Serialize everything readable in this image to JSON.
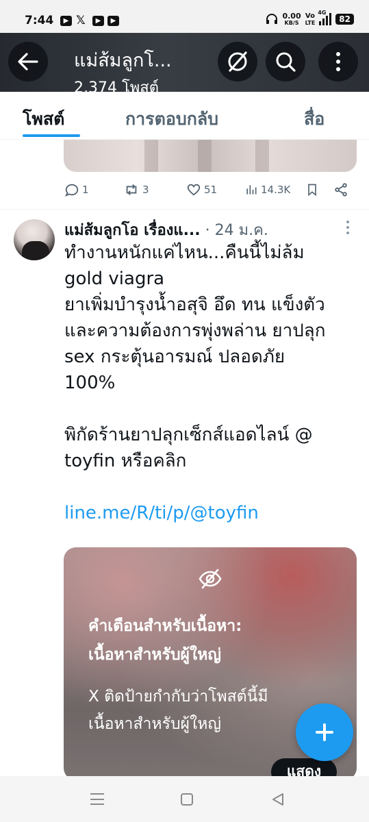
{
  "status_bar": {
    "time": "7:44",
    "net_speed": "0.00",
    "net_unit": "KB/S",
    "volte": "Vo",
    "lte": "LTE",
    "network": "4G",
    "battery": "82"
  },
  "header": {
    "title": "แม่ส้มลูกโ...",
    "subtitle": "2,374 โพสต์"
  },
  "tabs": [
    {
      "label": "โพสต์",
      "active": true
    },
    {
      "label": "การตอบกลับ",
      "active": false
    },
    {
      "label": "สื่อ",
      "active": false
    }
  ],
  "prev_post_actions": {
    "replies": "1",
    "reposts": "3",
    "likes": "51",
    "views": "14.3K"
  },
  "post": {
    "author": "แม่ส้มลูกโอ เรื่องแ...",
    "separator": "·",
    "time": "24 ม.ค.",
    "lines": [
      "ทำงานหนักแค่ไหน...คืนนี้ไม่ล้ม",
      "gold viagra",
      "ยาเพิ่มบำรุงน้ำอสุจิ อึด ทน แข็งตัว",
      "และความต้องการพุ่งพล่าน ยาปลุก",
      "sex กระตุ้นอารมณ์ ปลอดภัย",
      "100%",
      "",
      "พิกัดร้านยาปลุกเซ็กส์แอดไลน์ @",
      "toyfin หรือคลิก",
      ""
    ],
    "link": "line.me/R/ti/p/@toyfin",
    "media_warning": {
      "title_line1": "คำเตือนสำหรับเนื้อหา:",
      "title_line2": "เนื้อหาสำหรับผู้ใหญ่",
      "desc_line1": "X ติดป้ายกำกับว่าโพสต์นี้มี",
      "desc_line2": "เนื้อหาสำหรับผู้ใหญ่",
      "show_button": "แสดง"
    }
  },
  "colors": {
    "accent": "#1d9bf0",
    "text_primary": "#0f1419",
    "text_secondary": "#536471"
  }
}
